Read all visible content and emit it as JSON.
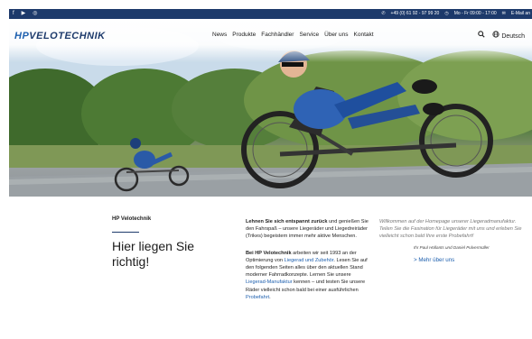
{
  "topbar": {
    "social": [
      "f",
      "▶",
      "◎"
    ],
    "phone": "+49 (0) 61 92 - 97 99 20",
    "hours": "Mo - Fr 09:00 - 17:00",
    "email": "E-Mail an"
  },
  "header": {
    "logo_hp": "HP",
    "logo_rest": "VELOTECHNIK",
    "nav": [
      "News",
      "Produkte",
      "Fachhändler",
      "Service",
      "Über uns",
      "Kontakt"
    ],
    "language": "Deutsch"
  },
  "content": {
    "kicker": "HP Velotechnik",
    "headline_line1": "Hier liegen Sie",
    "headline_line2": "richtig!",
    "p1_bold": "Lehnen Sie sich entspannt zurück",
    "p1_rest": " und genießen Sie den Fahrspaß – unsere Liegeräder und Liegedreiräder (Trikes) begeistern immer mehr aktive Menschen.",
    "p2_bold": "Bei HP Velotechnik",
    "p2_a": " arbeiten wir seit 1993 an der Optimierung von ",
    "p2_link1": "Liegerad und Zubehör",
    "p2_b": ". Lesen Sie auf den folgenden Seiten alles über den aktuellen Stand moderner Fahrradkonzepte. Lernen Sie unsere ",
    "p2_link2": "Liegerad-Manufaktur",
    "p2_c": " kennen – und testen Sie unsere Räder vielleicht schon bald bei einer ausführlichen ",
    "p2_link3": "Probefahrt",
    "p2_d": ".",
    "quote": "Willkommen auf der Homepage unserer Liegeradmanufaktur. Teilen Sie die Fasination für Liegeräder mit uns und erleben Sie vielleicht schon bald Ihre erste Probefahrt!",
    "signature": "Ihr Paul Hollants und Daniel Pulvermüller",
    "more_link": "> Mehr über uns"
  }
}
